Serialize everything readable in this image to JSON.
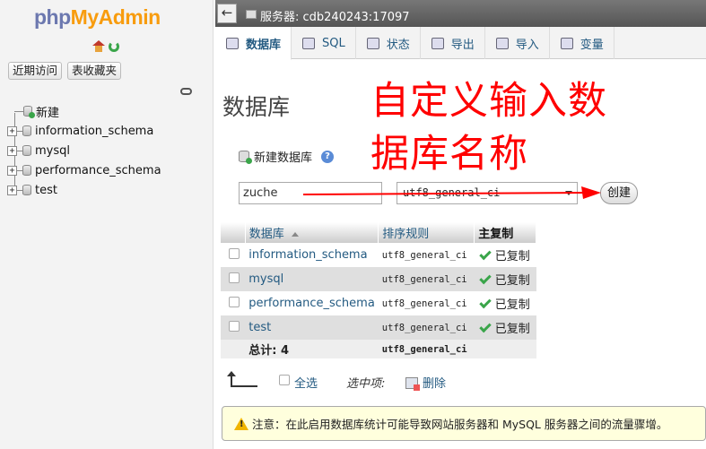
{
  "nav": {
    "logo_php": "php",
    "logo_admin": "MyAdmin",
    "recent_label": "近期访问",
    "favorites_label": "表收藏夹",
    "tree": [
      {
        "label": "新建"
      },
      {
        "label": "information_schema"
      },
      {
        "label": "mysql"
      },
      {
        "label": "performance_schema"
      },
      {
        "label": "test"
      }
    ]
  },
  "topbar": {
    "back_label": "←",
    "server_text": "服务器: cdb240243:17097"
  },
  "tabs": [
    {
      "label": "数据库",
      "icon": "database-icon",
      "active": true
    },
    {
      "label": "SQL",
      "icon": "sql-icon"
    },
    {
      "label": "状态",
      "icon": "status-icon"
    },
    {
      "label": "导出",
      "icon": "export-icon"
    },
    {
      "label": "导入",
      "icon": "import-icon"
    },
    {
      "label": "变量",
      "icon": "variables-icon"
    }
  ],
  "main": {
    "title": "数据库",
    "annotation_line1": "自定义输入数",
    "annotation_line2": "据库名称",
    "create_label": "新建数据库",
    "help_glyph": "?",
    "db_name_value": "zuche",
    "collation_value": "utf8_general_ci",
    "create_button": "创建"
  },
  "table": {
    "headers": {
      "name": "数据库",
      "collation": "排序规则",
      "replication": "主复制"
    },
    "rows": [
      {
        "name": "information_schema",
        "collation": "utf8_general_ci",
        "replication": "已复制"
      },
      {
        "name": "mysql",
        "collation": "utf8_general_ci",
        "replication": "已复制"
      },
      {
        "name": "performance_schema",
        "collation": "utf8_general_ci",
        "replication": "已复制"
      },
      {
        "name": "test",
        "collation": "utf8_general_ci",
        "replication": "已复制"
      }
    ],
    "total_label": "总计: 4",
    "total_collation": "utf8_general_ci"
  },
  "actions": {
    "select_all": "全选",
    "with_selected": "选中项:",
    "delete": "删除"
  },
  "notice": {
    "text": "注意：在此启用数据库统计可能导致网站服务器和 MySQL 服务器之间的流量骤增。"
  },
  "colors": {
    "annotation": "#ff0000",
    "link": "#235a81",
    "logo_php": "#6c78af",
    "logo_admin": "#f89c0e"
  }
}
